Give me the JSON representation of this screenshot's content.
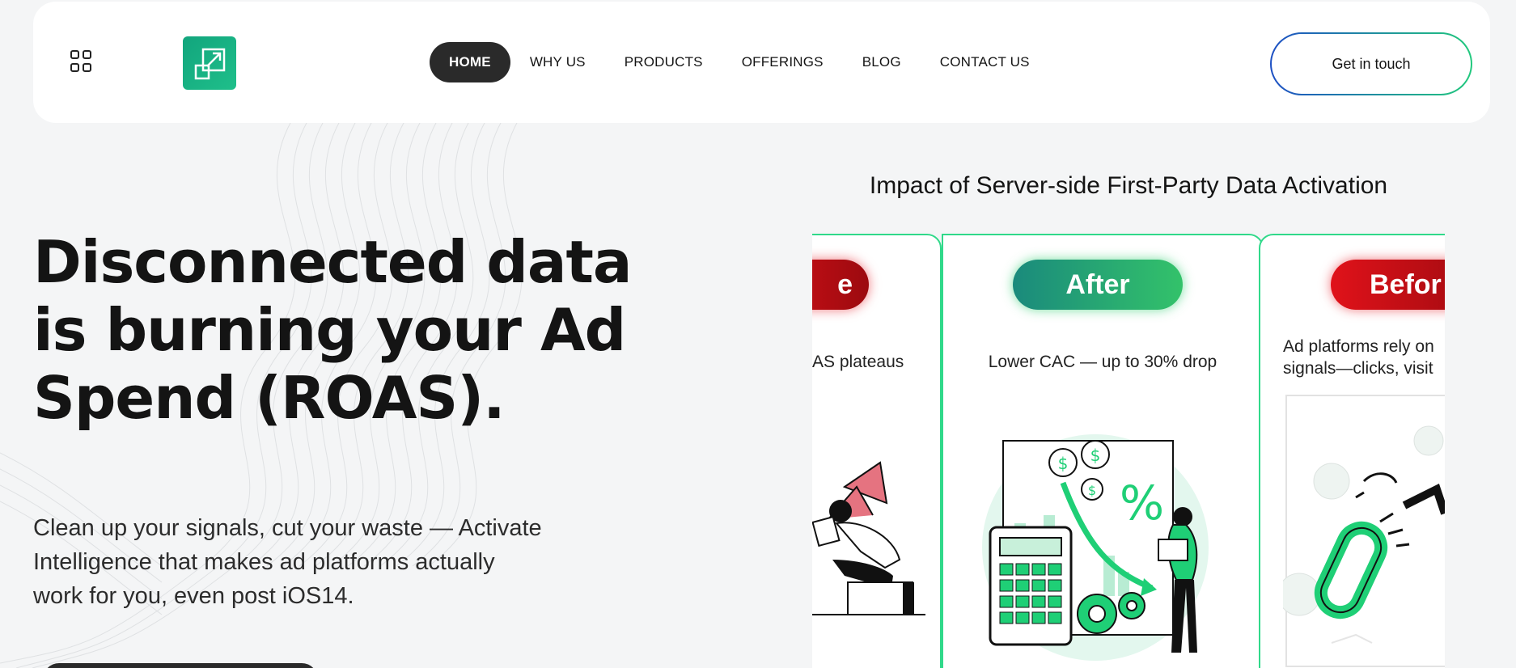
{
  "nav": {
    "items": [
      {
        "label": "HOME",
        "active": true
      },
      {
        "label": "WHY US"
      },
      {
        "label": "PRODUCTS"
      },
      {
        "label": "OFFERINGS"
      },
      {
        "label": "BLOG"
      },
      {
        "label": "CONTACT US"
      }
    ],
    "cta_label": "Get in touch"
  },
  "hero": {
    "title_lines": [
      "Disconnected data",
      "is burning your Ad",
      "Spend (ROAS)."
    ],
    "subtitle_lines": [
      "Clean up your signals, cut your waste — Activate",
      "Intelligence that makes ad platforms actually",
      "work for you, even post iOS14."
    ]
  },
  "impact": {
    "title": "Impact of Server-side First-Party Data Activation",
    "cards": [
      {
        "badge": "e",
        "text": "AS plateaus",
        "tone": "before"
      },
      {
        "badge": "After",
        "text": "Lower CAC — up to 30% drop",
        "tone": "after"
      },
      {
        "badge": "Befor",
        "text_lines": [
          "Ad platforms rely on",
          "signals—clicks, visit"
        ],
        "tone": "before"
      }
    ]
  },
  "colors": {
    "accent_green": "#30d98a",
    "brand_green": "#12a57d",
    "before_red": "#e0121a",
    "dark": "#2a2a2a"
  },
  "icons": {
    "menu": "grid-icon",
    "logo": "external-link-icon"
  }
}
